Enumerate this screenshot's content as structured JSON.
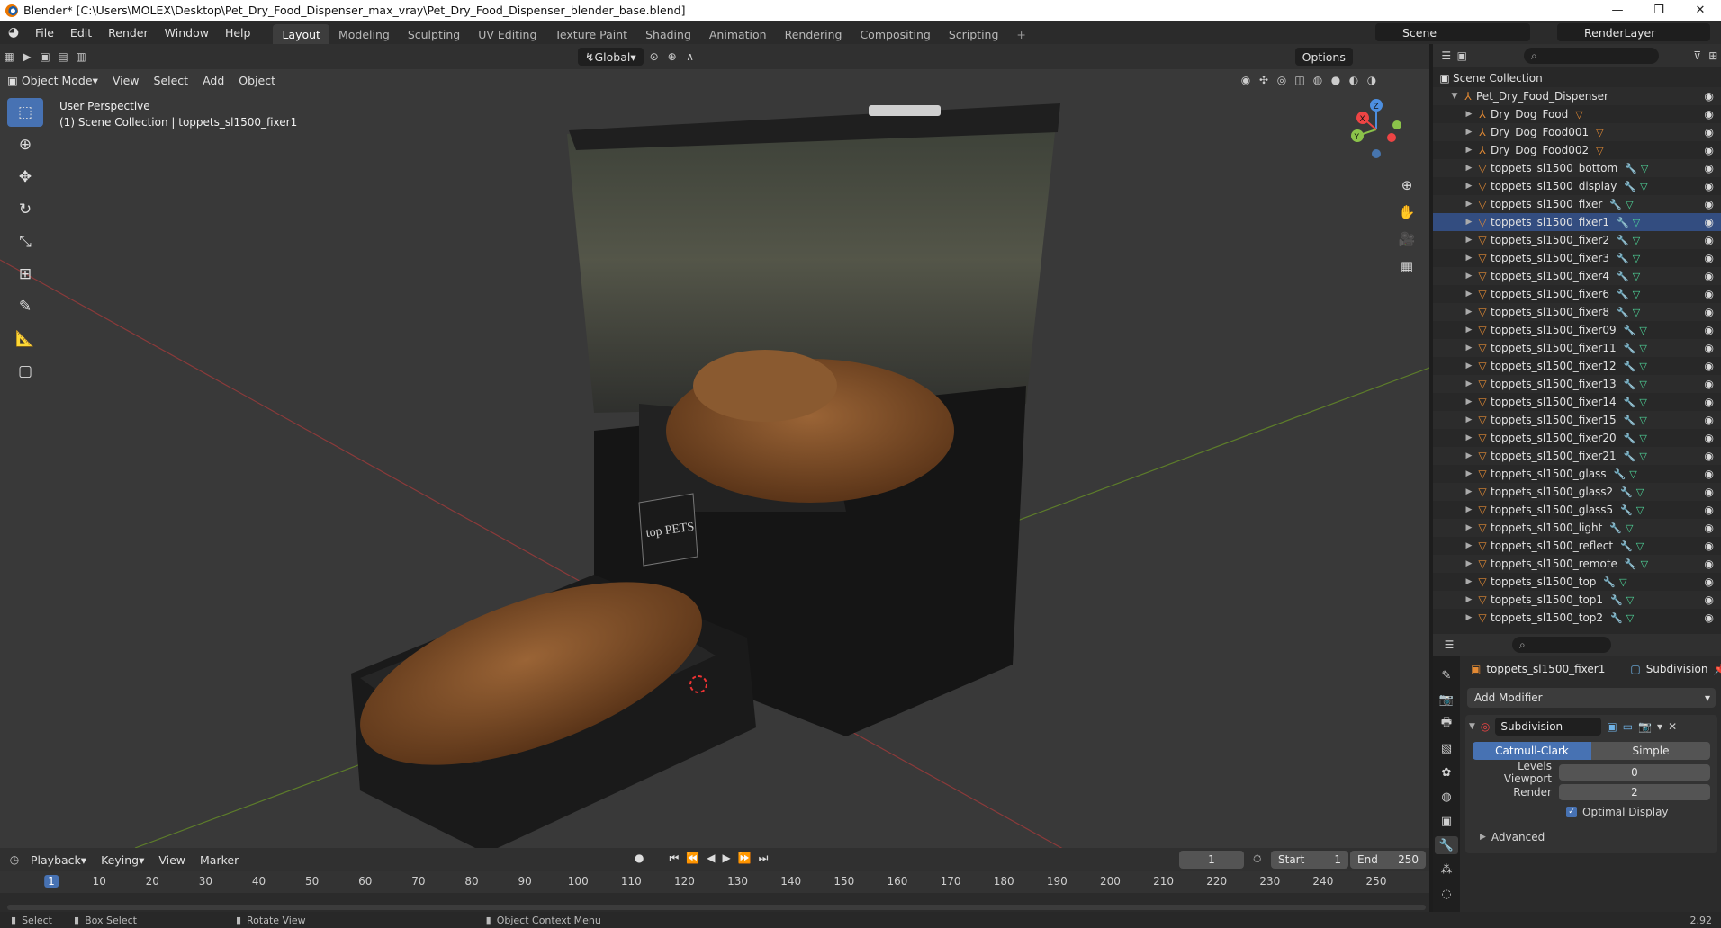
{
  "window": {
    "title": "Blender* [C:\\Users\\MOLEX\\Desktop\\Pet_Dry_Food_Dispenser_max_vray\\Pet_Dry_Food_Dispenser_blender_base.blend]",
    "minimize": "—",
    "maximize": "❐",
    "close": "✕"
  },
  "menu": [
    "File",
    "Edit",
    "Render",
    "Window",
    "Help"
  ],
  "workspaces": [
    "Layout",
    "Modeling",
    "Sculpting",
    "UV Editing",
    "Texture Paint",
    "Shading",
    "Animation",
    "Rendering",
    "Compositing",
    "Scripting"
  ],
  "workspace_add": "+",
  "scene": "Scene",
  "render_layer": "RenderLayer",
  "viewport": {
    "transform_orientation": "Global",
    "options_label": "Options",
    "mode": "Object Mode",
    "menus": [
      "View",
      "Select",
      "Add",
      "Object"
    ],
    "perspective": "User Perspective",
    "collection_info": "(1) Scene Collection | toppets_sl1500_fixer1",
    "logo_text": "top PETS"
  },
  "gizmo": {
    "z": "Z",
    "y": "Y",
    "x": "X"
  },
  "outliner": {
    "root": "Scene Collection",
    "collection": "Pet_Dry_Food_Dispenser",
    "items": [
      {
        "name": "Dry_Dog_Food",
        "kind": "empty"
      },
      {
        "name": "Dry_Dog_Food001",
        "kind": "empty"
      },
      {
        "name": "Dry_Dog_Food002",
        "kind": "empty"
      },
      {
        "name": "toppets_sl1500_bottom",
        "kind": "mesh"
      },
      {
        "name": "toppets_sl1500_display",
        "kind": "mesh"
      },
      {
        "name": "toppets_sl1500_fixer",
        "kind": "mesh"
      },
      {
        "name": "toppets_sl1500_fixer1",
        "kind": "mesh"
      },
      {
        "name": "toppets_sl1500_fixer2",
        "kind": "mesh"
      },
      {
        "name": "toppets_sl1500_fixer3",
        "kind": "mesh"
      },
      {
        "name": "toppets_sl1500_fixer4",
        "kind": "mesh"
      },
      {
        "name": "toppets_sl1500_fixer6",
        "kind": "mesh"
      },
      {
        "name": "toppets_sl1500_fixer8",
        "kind": "mesh"
      },
      {
        "name": "toppets_sl1500_fixer09",
        "kind": "mesh"
      },
      {
        "name": "toppets_sl1500_fixer11",
        "kind": "mesh"
      },
      {
        "name": "toppets_sl1500_fixer12",
        "kind": "mesh"
      },
      {
        "name": "toppets_sl1500_fixer13",
        "kind": "mesh"
      },
      {
        "name": "toppets_sl1500_fixer14",
        "kind": "mesh"
      },
      {
        "name": "toppets_sl1500_fixer15",
        "kind": "mesh"
      },
      {
        "name": "toppets_sl1500_fixer20",
        "kind": "mesh"
      },
      {
        "name": "toppets_sl1500_fixer21",
        "kind": "mesh"
      },
      {
        "name": "toppets_sl1500_glass",
        "kind": "mesh"
      },
      {
        "name": "toppets_sl1500_glass2",
        "kind": "mesh"
      },
      {
        "name": "toppets_sl1500_glass5",
        "kind": "mesh"
      },
      {
        "name": "toppets_sl1500_light",
        "kind": "mesh"
      },
      {
        "name": "toppets_sl1500_reflect",
        "kind": "mesh"
      },
      {
        "name": "toppets_sl1500_remote",
        "kind": "mesh"
      },
      {
        "name": "toppets_sl1500_top",
        "kind": "mesh"
      },
      {
        "name": "toppets_sl1500_top1",
        "kind": "mesh"
      },
      {
        "name": "toppets_sl1500_top2",
        "kind": "mesh"
      }
    ]
  },
  "properties": {
    "object_name": "toppets_sl1500_fixer1",
    "modifier_tab": "Subdivision",
    "add_modifier": "Add Modifier",
    "modifier": {
      "name": "Subdivision",
      "type_on": "Catmull-Clark",
      "type_off": "Simple",
      "levels_viewport_label": "Levels Viewport",
      "levels_viewport": "0",
      "render_label": "Render",
      "render": "2",
      "optimal_display_label": "Optimal Display",
      "advanced_label": "Advanced"
    }
  },
  "timeline": {
    "menus": [
      "Playback",
      "Keying",
      "View",
      "Marker"
    ],
    "current_frame": "1",
    "start_label": "Start",
    "start": "1",
    "end_label": "End",
    "end": "250",
    "ticks": [
      "1",
      "10",
      "20",
      "30",
      "40",
      "50",
      "60",
      "70",
      "80",
      "90",
      "100",
      "110",
      "120",
      "130",
      "140",
      "150",
      "160",
      "170",
      "180",
      "190",
      "200",
      "210",
      "220",
      "230",
      "240",
      "250"
    ]
  },
  "statusbar": {
    "select": "Select",
    "box_select": "Box Select",
    "rotate_view": "Rotate View",
    "context_menu": "Object Context Menu",
    "version": "2.92"
  },
  "colors": {
    "accent": "#4772b3",
    "viewport_bg": "#393939",
    "panel_bg": "#282828",
    "mesh_icon": "#e38a34",
    "modifier_icon": "#6fb2e6",
    "mesh_data_icon": "#4fd69a"
  }
}
